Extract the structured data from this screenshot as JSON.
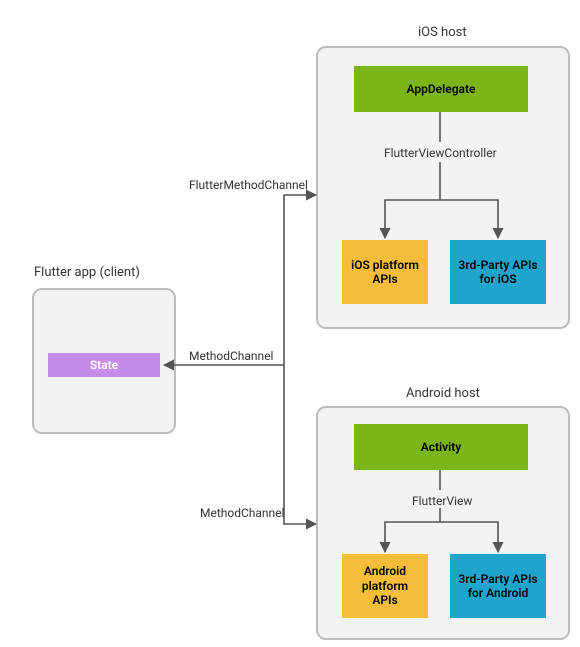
{
  "diagram": {
    "client": {
      "title": "Flutter app (client)",
      "state": "State"
    },
    "ios": {
      "title": "iOS host",
      "app_delegate": "AppDelegate",
      "fvc": "FlutterViewController",
      "platform_apis": "iOS platform APIs",
      "third_party": "3rd-Party APIs for iOS"
    },
    "android": {
      "title": "Android host",
      "activity": "Activity",
      "flutter_view": "FlutterView",
      "platform_apis": "Android platform APIs",
      "third_party": "3rd-Party APIs for Android"
    },
    "edges": {
      "to_ios": "FlutterMethodChannel",
      "to_client": "MethodChannel",
      "to_android": "MethodChannel"
    }
  }
}
